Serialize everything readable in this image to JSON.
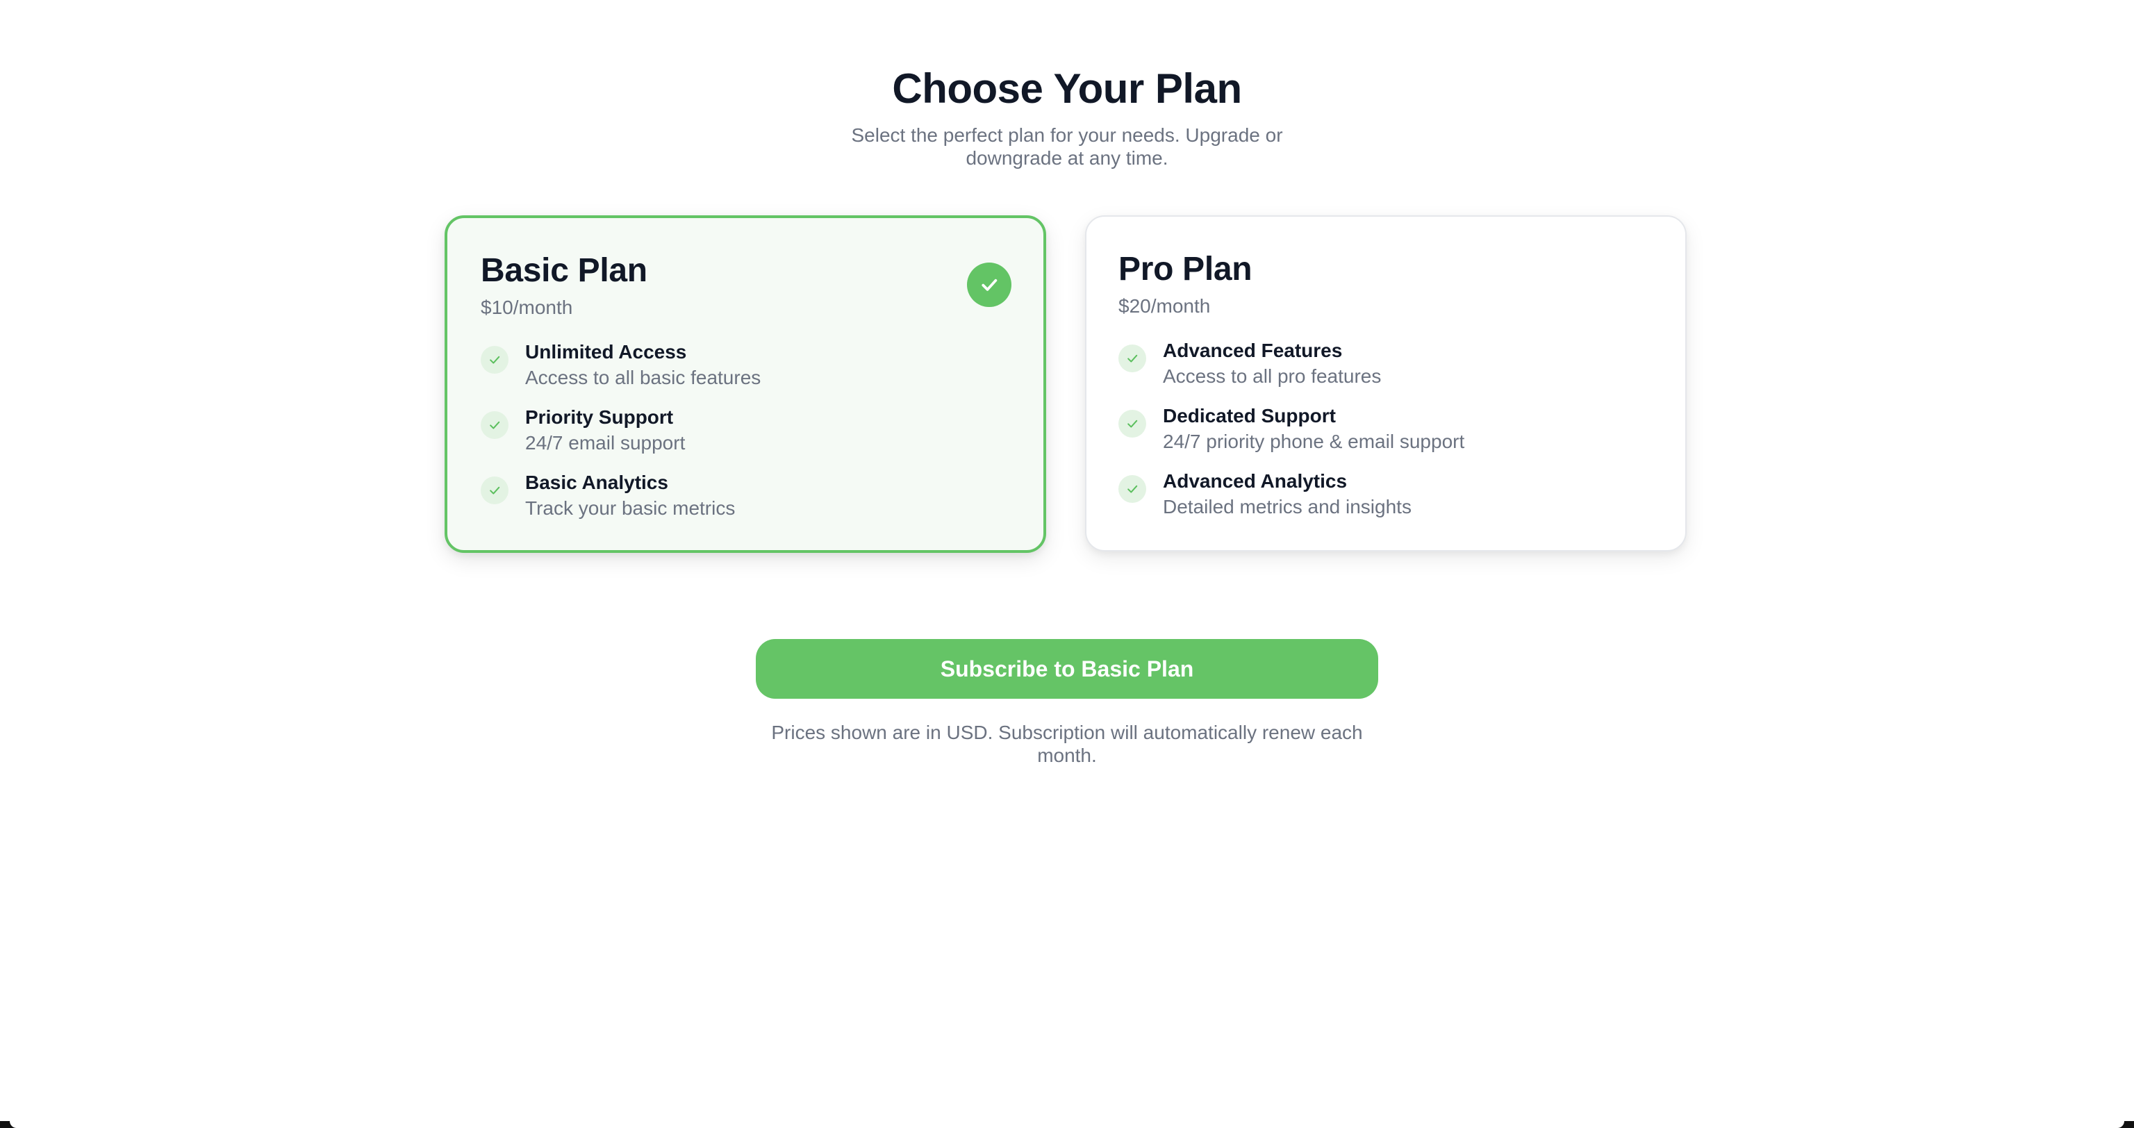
{
  "header": {
    "title": "Choose Your Plan",
    "subtitle": "Select the perfect plan for your needs. Upgrade or downgrade at any time."
  },
  "plans": [
    {
      "name": "Basic Plan",
      "price": "$10/month",
      "selected": true,
      "features": [
        {
          "title": "Unlimited Access",
          "description": "Access to all basic features"
        },
        {
          "title": "Priority Support",
          "description": "24/7 email support"
        },
        {
          "title": "Basic Analytics",
          "description": "Track your basic metrics"
        }
      ]
    },
    {
      "name": "Pro Plan",
      "price": "$20/month",
      "selected": false,
      "features": [
        {
          "title": "Advanced Features",
          "description": "Access to all pro features"
        },
        {
          "title": "Dedicated Support",
          "description": "24/7 priority phone & email support"
        },
        {
          "title": "Advanced Analytics",
          "description": "Detailed metrics and insights"
        }
      ]
    }
  ],
  "subscribe": {
    "label": "Subscribe to Basic Plan"
  },
  "footnote": "Prices shown are in USD. Subscription will automatically renew each month.",
  "colors": {
    "accent": "#65c466",
    "selected_card_bg": "#f5faf5",
    "feature_check_bg": "#e3f3e3",
    "title_text": "#111827",
    "muted_text": "#6b7280"
  },
  "icons": {
    "selected_badge": "check-circle-icon",
    "feature_check": "check-icon"
  }
}
